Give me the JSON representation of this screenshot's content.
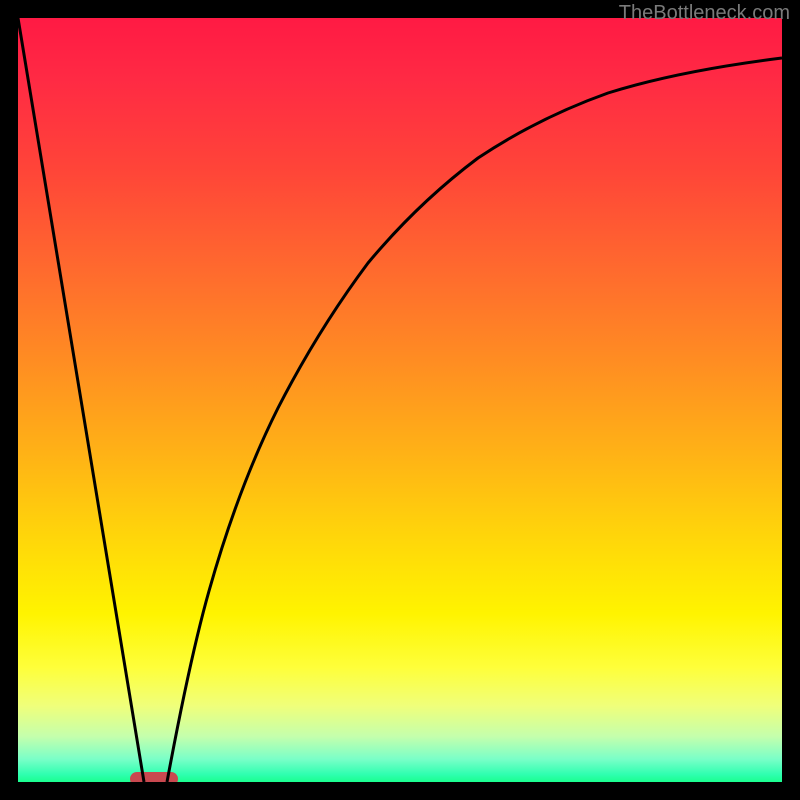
{
  "watermark": "TheBottleneck.com",
  "chart_data": {
    "type": "line",
    "title": "",
    "xlabel": "",
    "ylabel": "",
    "xlim": [
      0,
      100
    ],
    "ylim": [
      0,
      100
    ],
    "background_gradient": {
      "direction": "vertical",
      "stops": [
        {
          "pos": 0.0,
          "color": "#ff1a44"
        },
        {
          "pos": 0.2,
          "color": "#ff4538"
        },
        {
          "pos": 0.45,
          "color": "#ff8d22"
        },
        {
          "pos": 0.68,
          "color": "#ffd60a"
        },
        {
          "pos": 0.85,
          "color": "#feff3a"
        },
        {
          "pos": 0.97,
          "color": "#7affc8"
        },
        {
          "pos": 1.0,
          "color": "#1aff8f"
        }
      ]
    },
    "series": [
      {
        "name": "left-line",
        "type": "line",
        "x": [
          0,
          16.5
        ],
        "y": [
          100,
          0
        ]
      },
      {
        "name": "right-curve",
        "type": "line",
        "x": [
          19.5,
          25,
          30,
          35,
          40,
          45,
          50,
          55,
          60,
          65,
          70,
          75,
          80,
          85,
          90,
          95,
          100
        ],
        "y": [
          0,
          25,
          44,
          57,
          66,
          73,
          78,
          82,
          85,
          87.5,
          89.5,
          91,
          92,
          93,
          93.7,
          94.3,
          94.8
        ]
      }
    ],
    "annotations": {
      "marker_pill": {
        "x": 17.8,
        "y": 0,
        "width": 6,
        "color": "#c9484f"
      }
    }
  }
}
